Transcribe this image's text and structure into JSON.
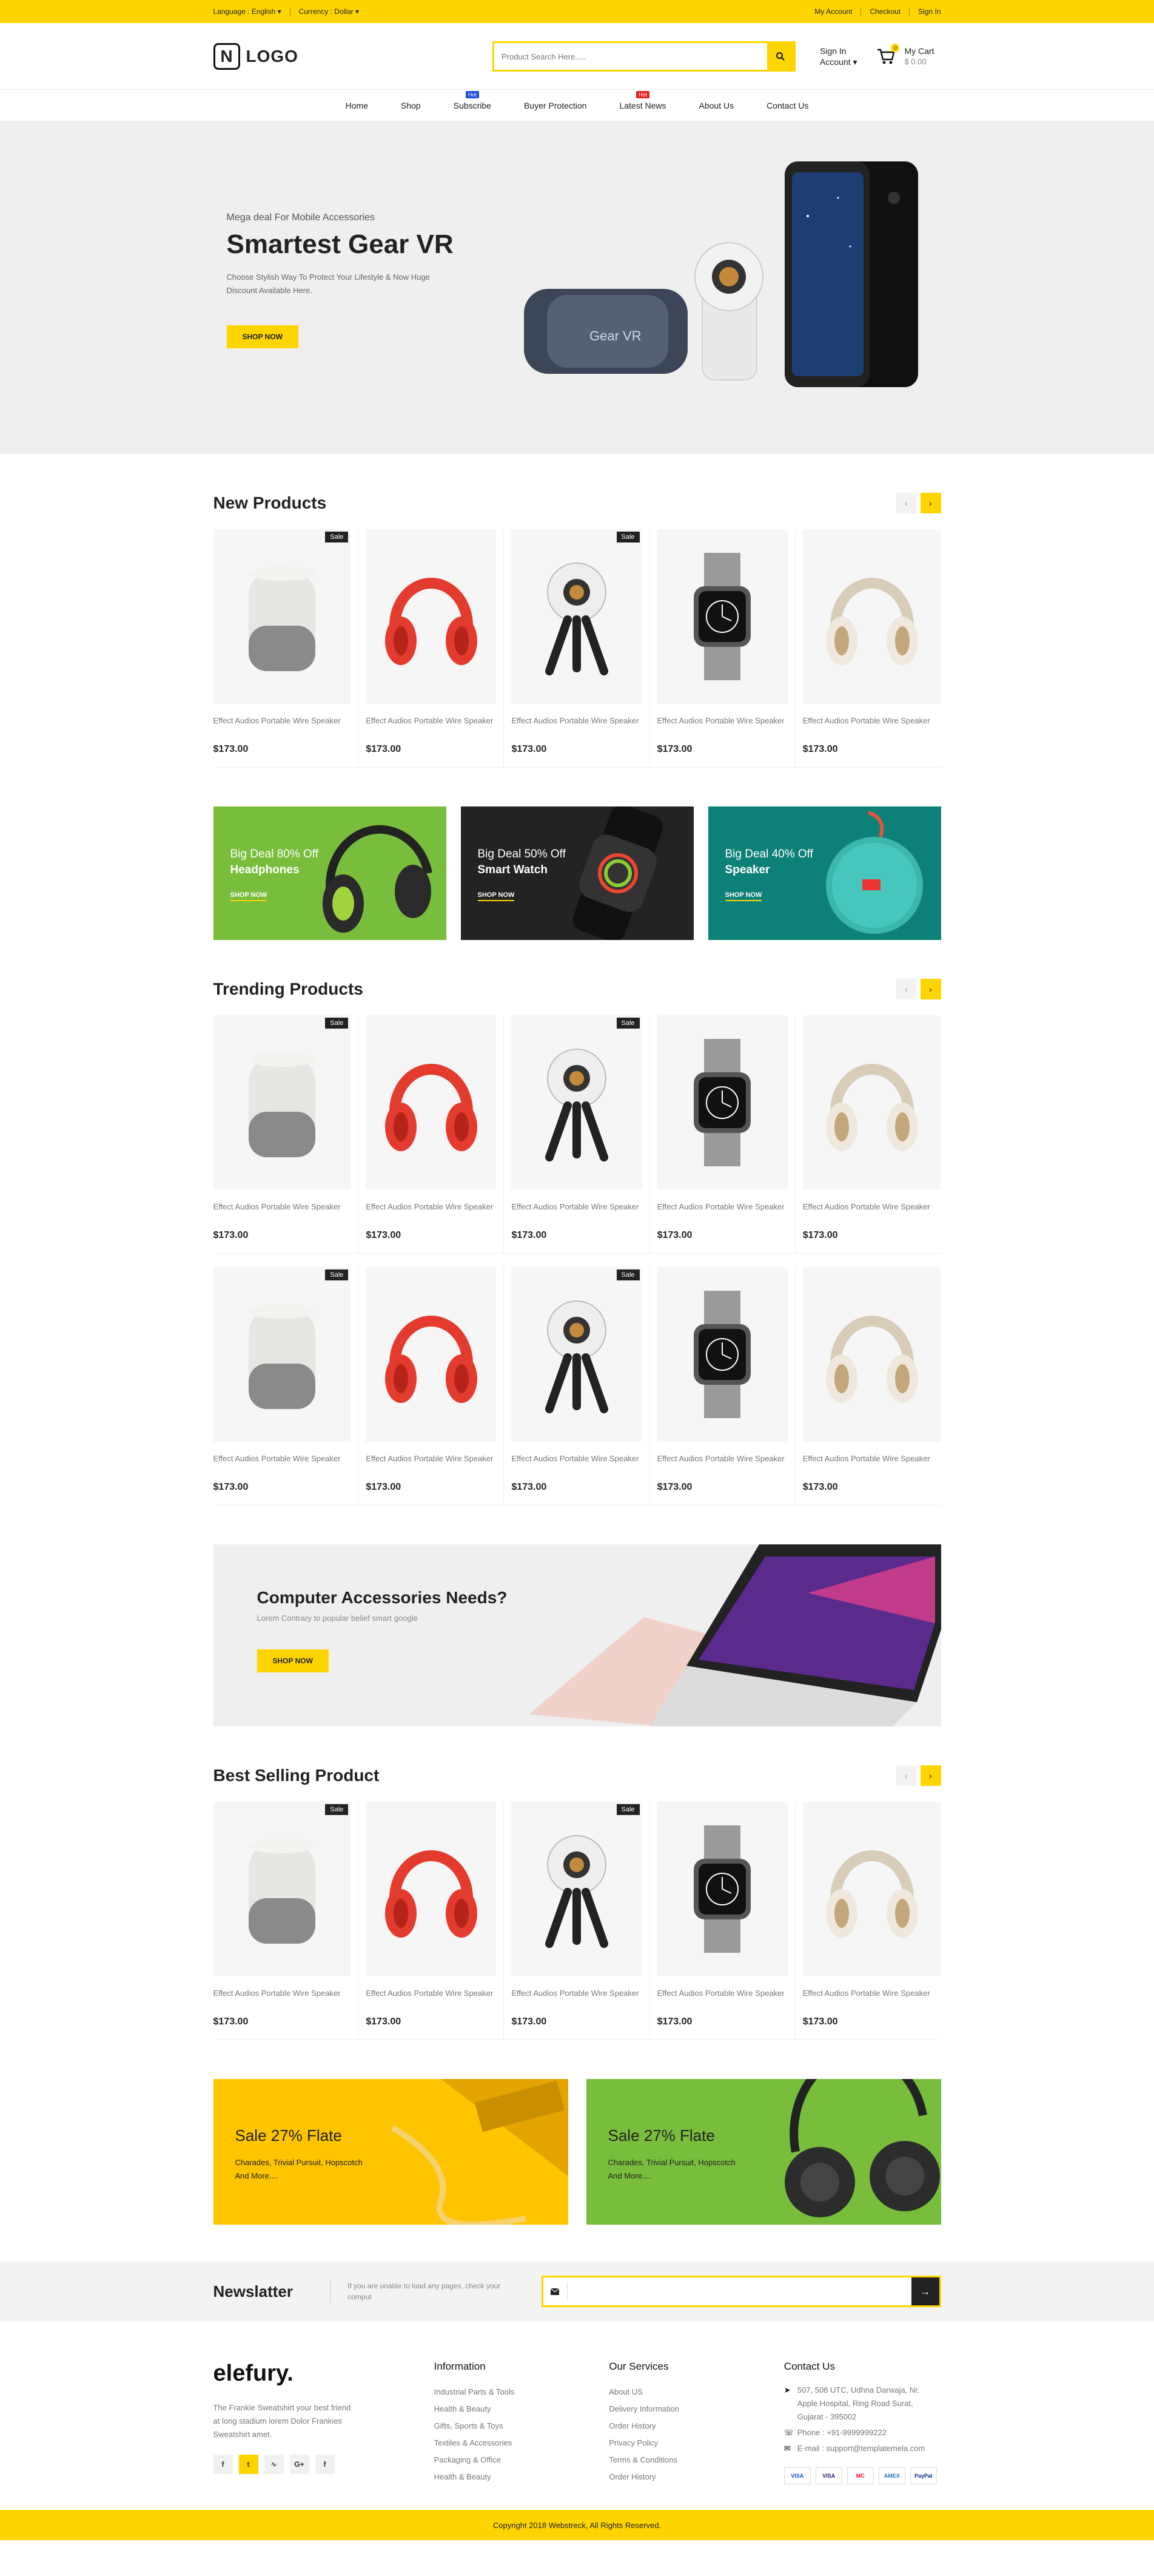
{
  "topbar": {
    "language": "Language : English",
    "currency": "Currency : Dollar",
    "my_account": "My Account",
    "checkout": "Checkout",
    "sign_in": "Sign In"
  },
  "header": {
    "logo_letter": "N",
    "logo_text": "LOGO",
    "search_placeholder": "Product Search Here.....",
    "account_line1": "Sign In",
    "account_line2": "Account",
    "cart_label": "My Cart",
    "cart_total": "$ 0.00",
    "cart_count": "0"
  },
  "nav": {
    "items": [
      {
        "label": "Home",
        "tag": ""
      },
      {
        "label": "Shop",
        "tag": ""
      },
      {
        "label": "Subscribe",
        "tag": "Hot"
      },
      {
        "label": "Buyer Protection",
        "tag": ""
      },
      {
        "label": "Latest News",
        "tag": "Hot"
      },
      {
        "label": "About Us",
        "tag": ""
      },
      {
        "label": "Contact Us",
        "tag": ""
      }
    ],
    "tag_colors": {
      "Subscribe": "#1a4fd6",
      "Latest News": "#e32020"
    }
  },
  "hero": {
    "subtitle": "Mega deal For Mobile Accessories",
    "title": "Smartest Gear VR",
    "description": "Choose Stylish Way To Protect Your Lifestyle & Now Huge Discount Available Here.",
    "button": "SHOP NOW"
  },
  "sections": {
    "new_products": "New Products",
    "trending_products": "Trending Products",
    "best_selling": "Best Selling Product"
  },
  "product": {
    "name": "Effect Audios Portable Wire Speaker",
    "price": "$173.00",
    "sale_label": "Sale"
  },
  "deals": [
    {
      "line1": "Big Deal 80% Off",
      "line2": "Headphones",
      "link": "SHOP NOW",
      "color": "#79bd3c"
    },
    {
      "line1": "Big Deal 50% Off",
      "line2": "Smart Watch",
      "link": "SHOP NOW",
      "color": "#232323"
    },
    {
      "line1": "Big Deal 40% Off",
      "line2": "Speaker",
      "link": "SHOP NOW",
      "color": "#0d8178"
    }
  ],
  "computer_banner": {
    "title": "Computer Accessories Needs?",
    "description": "Lorem Contrary to popular belief smart google",
    "button": "SHOP NOW"
  },
  "sale_banners": [
    {
      "title": "Sale 27% Flate",
      "description": "Charades, Trivial Pursuit, Hopscotch And More....",
      "color": "#ffc400"
    },
    {
      "title": "Sale 27% Flate",
      "description": "Charades, Trivial Pursuit, Hopscotch And More....",
      "color": "#79bd3c"
    }
  ],
  "newsletter": {
    "title": "Newslatter",
    "description": "If you are unable to load any pages, check your comput"
  },
  "footer": {
    "brand": "elefury.",
    "brand_desc": "The Frankie Sweatshirt your best friend at long stadium lorem Dolor Frankies Sweatshirt amet.",
    "information_title": "Information",
    "information": [
      "Industrial Parts & Tools",
      "Health & Beauty",
      "Gifts, Sports & Toys",
      "Textiles & Accessories",
      "Packaging & Office",
      "Health & Beauty"
    ],
    "services_title": "Our Services",
    "services": [
      "About US",
      "Delivery Information",
      "Order History",
      "Privacy Policy",
      "Terms & Conditions",
      "Order History"
    ],
    "contact_title": "Contact Us",
    "address": "507, 508 UTC, Udhna Darwaja, Nr. Apple Hospital, Ring Road Surat, Gujarat - 395002",
    "phone": "Phone : +91-9999999222",
    "email": "E-mail : support@templatemela.com",
    "payments": [
      "VISA",
      "VISA",
      "MC",
      "AMEX",
      "PayPal"
    ],
    "copyright": "Copyright 2018 Webstreck, All Rights Reserved."
  }
}
